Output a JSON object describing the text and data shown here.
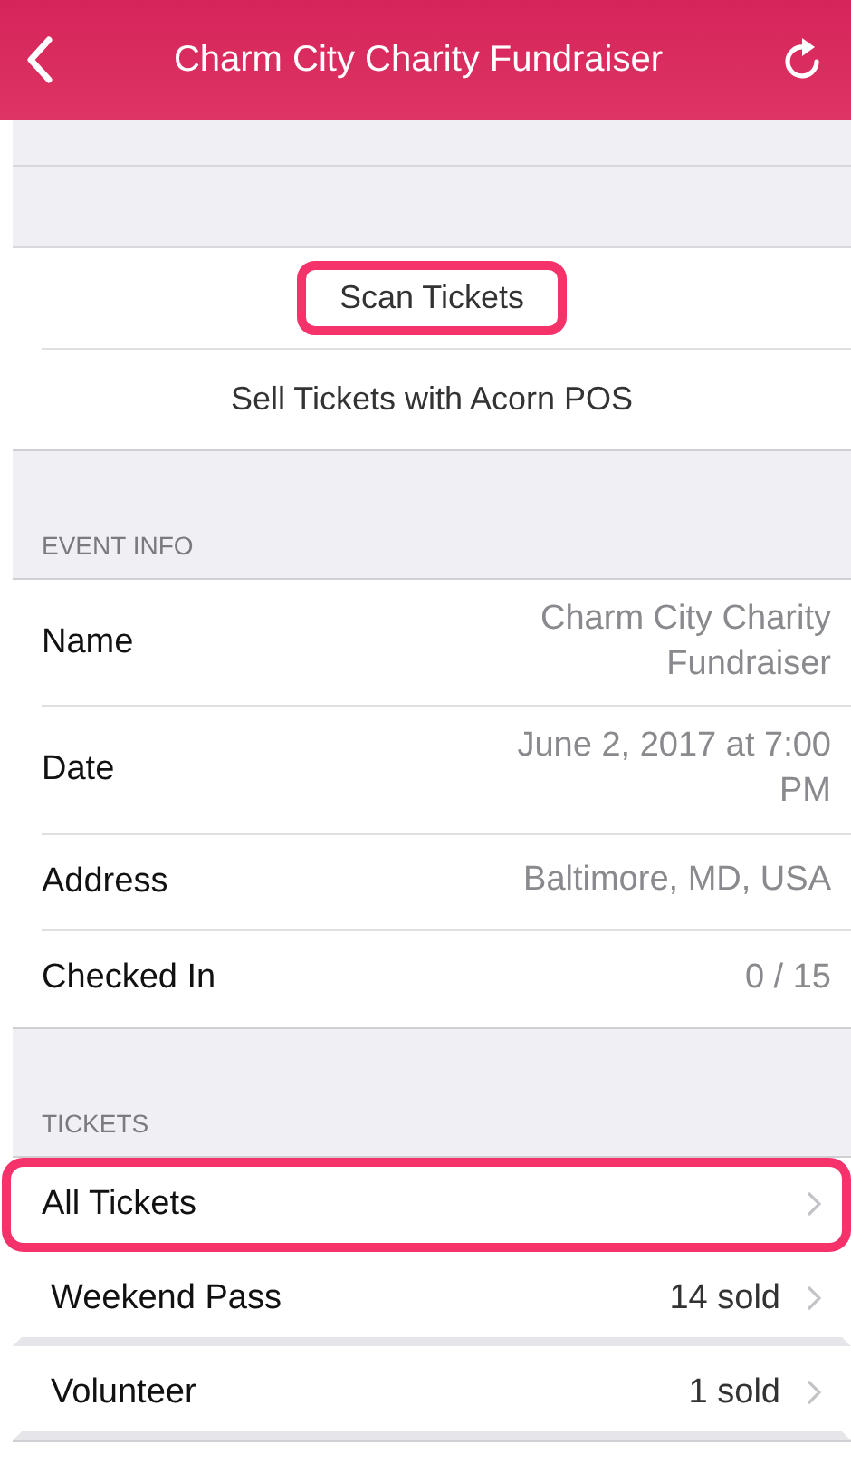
{
  "nav": {
    "title": "Charm City Charity Fundraiser"
  },
  "actions": [
    {
      "label": "Scan Tickets",
      "highlighted": true
    },
    {
      "label": "Sell Tickets with Acorn POS",
      "highlighted": false
    }
  ],
  "event_info": {
    "header": "EVENT INFO",
    "rows": [
      {
        "label": "Name",
        "value": "Charm City Charity Fundraiser"
      },
      {
        "label": "Date",
        "value": "June 2, 2017 at 7:00 PM"
      },
      {
        "label": "Address",
        "value": "Baltimore, MD, USA"
      },
      {
        "label": "Checked In",
        "value": "0 / 15"
      }
    ]
  },
  "tickets": {
    "header": "TICKETS",
    "rows": [
      {
        "label": "All Tickets",
        "highlighted": true
      },
      {
        "label": "Weekend Pass",
        "value": "14 sold",
        "highlighted": false
      },
      {
        "label": "Volunteer",
        "value": "1 sold",
        "highlighted": false
      }
    ]
  }
}
